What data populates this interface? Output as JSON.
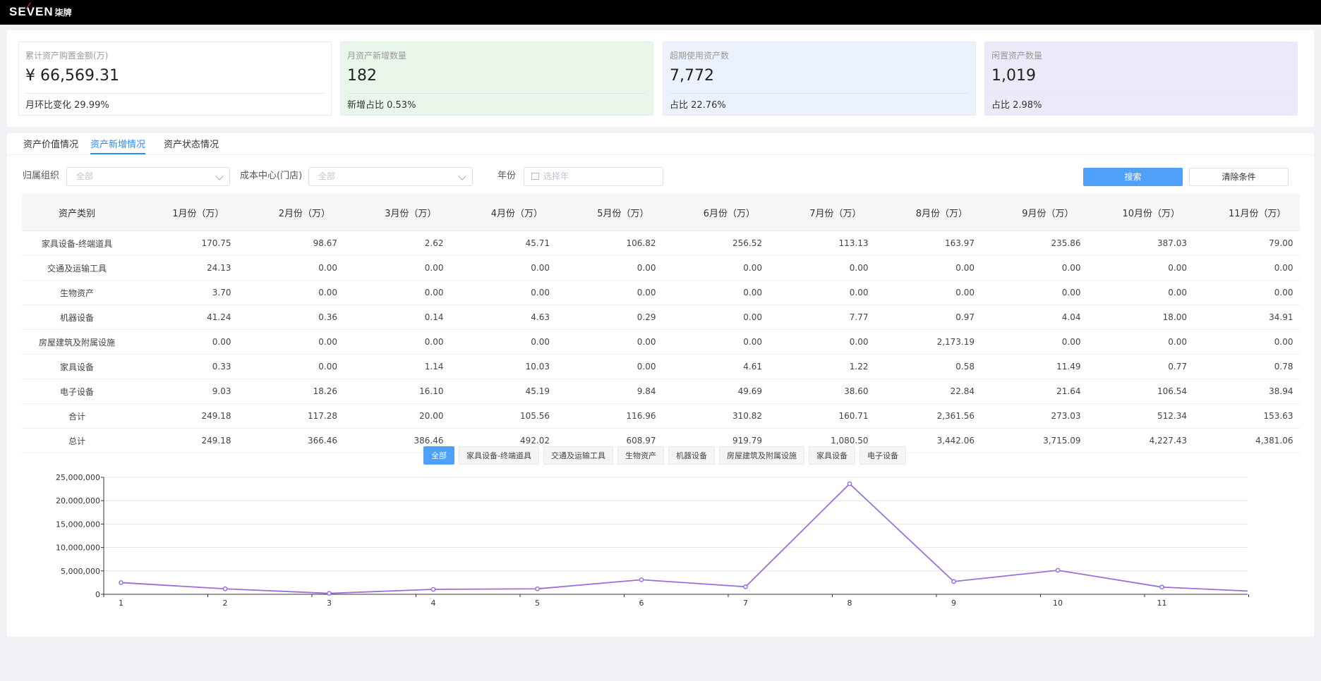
{
  "brand": {
    "logo_text": "SEVEN",
    "logo_cn": "柒牌"
  },
  "cards": [
    {
      "title": "累计资产购置金额(万)",
      "value": "¥ 66,569.31",
      "footer": "月环比变化 29.99%",
      "bg": "#ffffff"
    },
    {
      "title": "月资产新增数量",
      "value": "182",
      "footer": "新增占比 0.53%",
      "bg": "#e9f6ea"
    },
    {
      "title": "超期使用资产数",
      "value": "7,772",
      "footer": "占比 22.76%",
      "bg": "#ebf2fd"
    },
    {
      "title": "闲置资产数量",
      "value": "1,019",
      "footer": "占比 2.98%",
      "bg": "#ece9f8"
    }
  ],
  "tabs": [
    {
      "label": "资产价值情况",
      "active": false
    },
    {
      "label": "资产新增情况",
      "active": true
    },
    {
      "label": "资产状态情况",
      "active": false
    }
  ],
  "filters": {
    "org_label": "归属组织",
    "org_placeholder": "全部",
    "cost_label": "成本中心(门店)",
    "cost_placeholder": "全部",
    "year_label": "年份",
    "year_placeholder": "选择年",
    "search_button": "搜索",
    "clear_button": "清除条件"
  },
  "table": {
    "headers": [
      "资产类别",
      "1月份（万）",
      "2月份（万）",
      "3月份（万）",
      "4月份（万）",
      "5月份（万）",
      "6月份（万）",
      "7月份（万）",
      "8月份（万）",
      "9月份（万）",
      "10月份（万）",
      "11月份（万）"
    ],
    "rows": [
      [
        "家具设备-终端道具",
        "170.75",
        "98.67",
        "2.62",
        "45.71",
        "106.82",
        "256.52",
        "113.13",
        "163.97",
        "235.86",
        "387.03",
        "79.00"
      ],
      [
        "交通及运输工具",
        "24.13",
        "0.00",
        "0.00",
        "0.00",
        "0.00",
        "0.00",
        "0.00",
        "0.00",
        "0.00",
        "0.00",
        "0.00"
      ],
      [
        "生物资产",
        "3.70",
        "0.00",
        "0.00",
        "0.00",
        "0.00",
        "0.00",
        "0.00",
        "0.00",
        "0.00",
        "0.00",
        "0.00"
      ],
      [
        "机器设备",
        "41.24",
        "0.36",
        "0.14",
        "4.63",
        "0.29",
        "0.00",
        "7.77",
        "0.97",
        "4.04",
        "18.00",
        "34.91"
      ],
      [
        "房屋建筑及附属设施",
        "0.00",
        "0.00",
        "0.00",
        "0.00",
        "0.00",
        "0.00",
        "0.00",
        "2,173.19",
        "0.00",
        "0.00",
        "0.00"
      ],
      [
        "家具设备",
        "0.33",
        "0.00",
        "1.14",
        "10.03",
        "0.00",
        "4.61",
        "1.22",
        "0.58",
        "11.49",
        "0.77",
        "0.78"
      ],
      [
        "电子设备",
        "9.03",
        "18.26",
        "16.10",
        "45.19",
        "9.84",
        "49.69",
        "38.60",
        "22.84",
        "21.64",
        "106.54",
        "38.94"
      ],
      [
        "合计",
        "249.18",
        "117.28",
        "20.00",
        "105.56",
        "116.96",
        "310.82",
        "160.71",
        "2,361.56",
        "273.03",
        "512.34",
        "153.63"
      ],
      [
        "总计",
        "249.18",
        "366.46",
        "386.46",
        "492.02",
        "608.97",
        "919.79",
        "1,080.50",
        "3,442.06",
        "3,715.09",
        "4,227.43",
        "4,381.06"
      ]
    ]
  },
  "chips": [
    {
      "label": "全部",
      "active": true
    },
    {
      "label": "家具设备-终端道具",
      "active": false
    },
    {
      "label": "交通及运输工具",
      "active": false
    },
    {
      "label": "生物资产",
      "active": false
    },
    {
      "label": "机器设备",
      "active": false
    },
    {
      "label": "房屋建筑及附属设施",
      "active": false
    },
    {
      "label": "家具设备",
      "active": false
    },
    {
      "label": "电子设备",
      "active": false
    }
  ],
  "colors": {
    "accent": "#2f8cf0",
    "line": "#9b6fd9"
  },
  "chart_data": {
    "type": "line",
    "x": [
      1,
      2,
      3,
      4,
      5,
      6,
      7,
      8,
      9,
      10,
      11,
      12
    ],
    "x_tick_labels": [
      "1",
      "2",
      "3",
      "4",
      "5",
      "6",
      "7",
      "8",
      "9",
      "10",
      "11"
    ],
    "series": [
      {
        "values": [
          2491800,
          1172800,
          200000,
          1055600,
          1169600,
          3108200,
          1607100,
          23615600,
          2730300,
          5123400,
          1536300,
          700000
        ]
      }
    ],
    "ylim": [
      0,
      25000000
    ],
    "y_ticks": [
      "0",
      "5,000,000",
      "10,000,000",
      "15,000,000",
      "20,000,000",
      "25,000,000"
    ],
    "grid": true
  }
}
